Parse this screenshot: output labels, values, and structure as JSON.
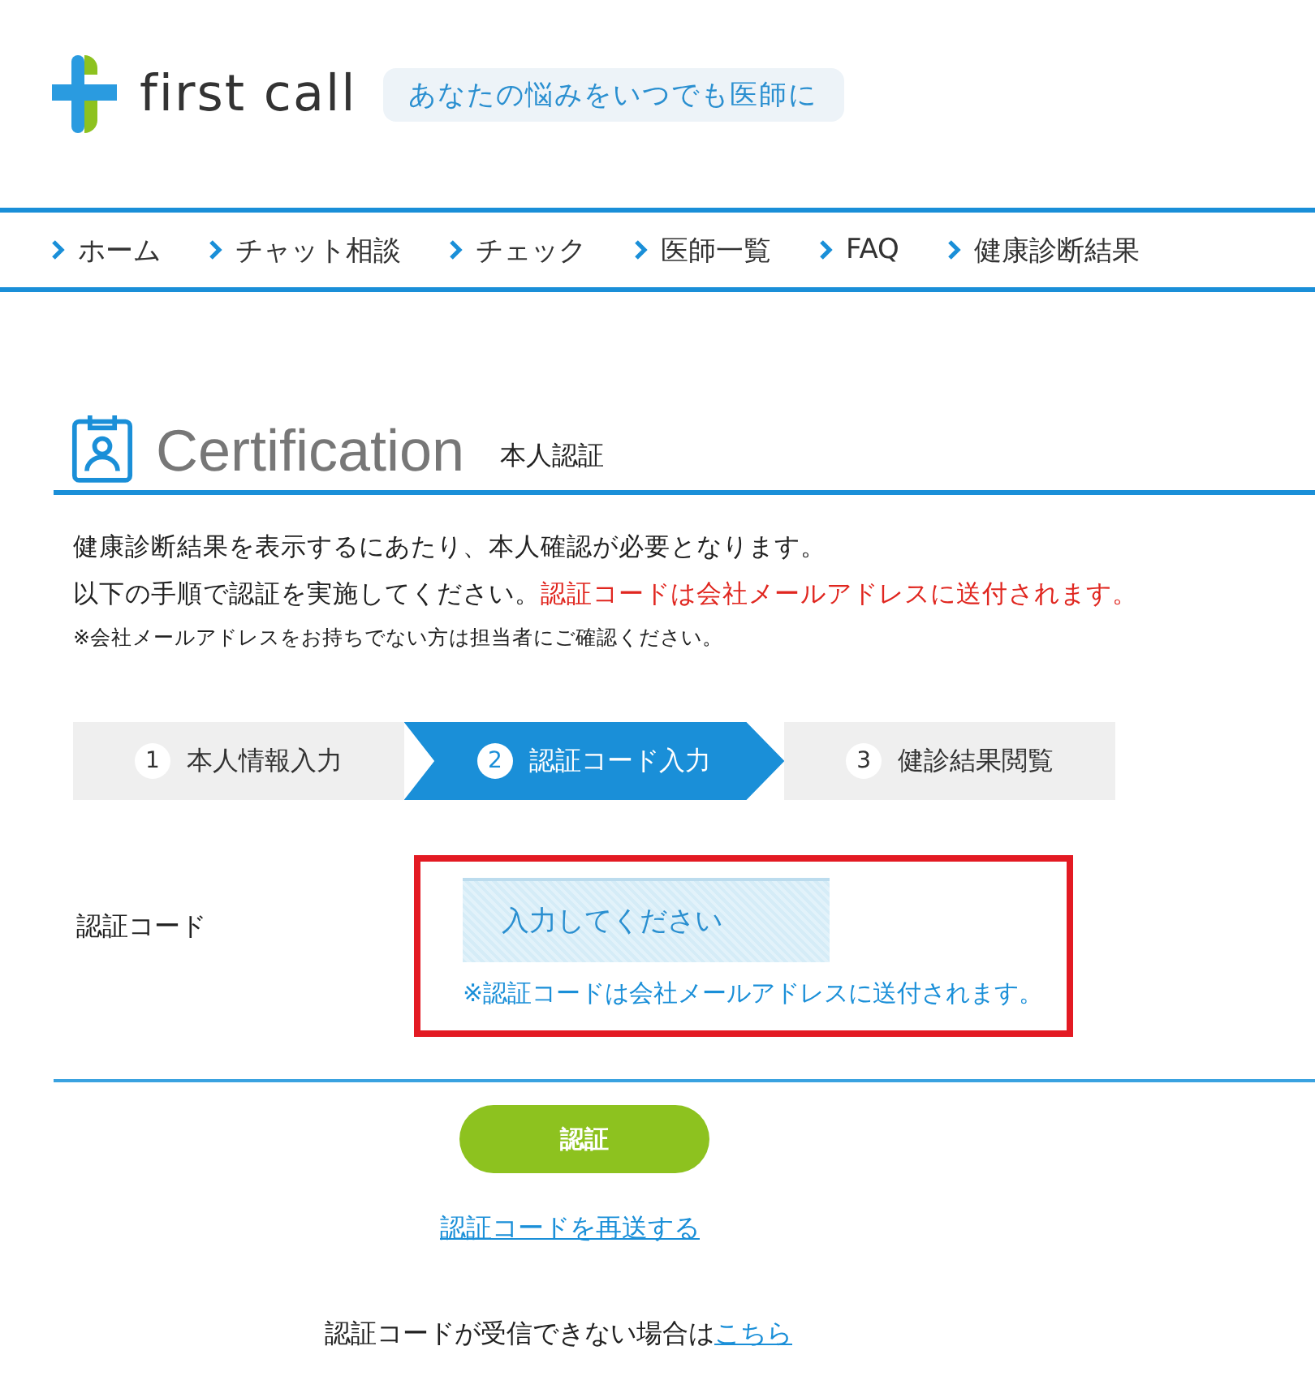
{
  "header": {
    "brand": "first call",
    "tagline": "あなたの悩みをいつでも医師に"
  },
  "nav": [
    {
      "label": "ホーム"
    },
    {
      "label": "チャット相談"
    },
    {
      "label": "チェック"
    },
    {
      "label": "医師一覧"
    },
    {
      "label": "FAQ"
    },
    {
      "label": "健康診断結果"
    }
  ],
  "page": {
    "title": "Certification",
    "subtitle": "本人認証"
  },
  "intro": {
    "line1": "健康診断結果を表示するにあたり、本人確認が必要となります。",
    "line2": "以下の手順で認証を実施してください。",
    "line2_emphasis": "認証コードは会社メールアドレスに送付されます。",
    "note": "※会社メールアドレスをお持ちでない方は担当者にご確認ください。"
  },
  "steps": [
    {
      "number": "1",
      "label": "本人情報入力",
      "selected": false
    },
    {
      "number": "2",
      "label": "認証コード入力",
      "selected": true
    },
    {
      "number": "3",
      "label": "健診結果閲覧",
      "selected": false
    }
  ],
  "form": {
    "label": "認証コード",
    "placeholder": "入力してください",
    "hint": "※認証コードは会社メールアドレスに送付されます。"
  },
  "submit_button": "認証",
  "resend_link": "認証コードを再送する",
  "help": {
    "text": "認証コードが受信できない場合は",
    "link": "こちら"
  }
}
